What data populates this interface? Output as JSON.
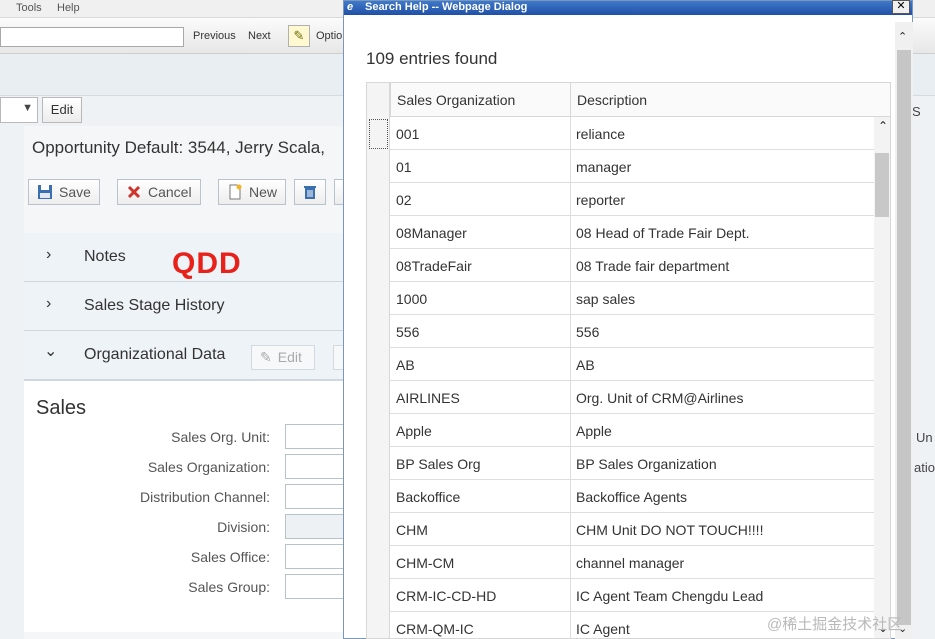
{
  "browser": {
    "menu": [
      "Tools",
      "Help"
    ],
    "toolbar": {
      "previous": "Previous",
      "next": "Next",
      "options": "Optio"
    }
  },
  "crm": {
    "edit_top": "Edit",
    "right_edge_s": "S",
    "title": "Opportunity Default: 3544, Jerry Scala,",
    "actions": {
      "save": "Save",
      "cancel": "Cancel",
      "new": "New"
    },
    "sections": [
      {
        "label": "Notes",
        "expanded": false
      },
      {
        "label": "Sales Stage History",
        "expanded": false
      },
      {
        "label": "Organizational Data",
        "expanded": true
      }
    ],
    "annotation": "QDD",
    "org_edit": "Edit",
    "sales_heading": "Sales",
    "fields": [
      {
        "label": "Sales Org. Unit:",
        "disabled": false
      },
      {
        "label": "Sales Organization:",
        "disabled": false
      },
      {
        "label": "Distribution Channel:",
        "disabled": false
      },
      {
        "label": "Division:",
        "disabled": true
      },
      {
        "label": "Sales Office:",
        "disabled": false
      },
      {
        "label": "Sales Group:",
        "disabled": false
      }
    ],
    "right_edge_un": "Un",
    "right_edge_ation": "ation"
  },
  "dialog": {
    "title": "Search Help -- Webpage Dialog",
    "close": "✕",
    "entries_found": "109 entries found",
    "columns": [
      "Sales Organization",
      "Description"
    ],
    "rows": [
      [
        "001",
        "reliance"
      ],
      [
        "01",
        "manager"
      ],
      [
        "02",
        "reporter"
      ],
      [
        "08Manager",
        "08 Head of Trade Fair Dept."
      ],
      [
        "08TradeFair",
        "08 Trade fair department"
      ],
      [
        "1000",
        "sap sales"
      ],
      [
        "556",
        "556"
      ],
      [
        "AB",
        "AB"
      ],
      [
        "AIRLINES",
        "Org. Unit of CRM@Airlines"
      ],
      [
        "Apple",
        "Apple"
      ],
      [
        "BP Sales Org",
        "BP Sales Organization"
      ],
      [
        "Backoffice",
        "Backoffice Agents"
      ],
      [
        "CHM",
        "CHM Unit DO NOT TOUCH!!!!"
      ],
      [
        "CHM-CM",
        "channel manager"
      ],
      [
        "CRM-IC-CD-HD",
        "IC Agent Team Chengdu Lead"
      ],
      [
        "CRM-QM-IC",
        "IC Agent"
      ]
    ]
  },
  "watermark": "@稀土掘金技术社区"
}
